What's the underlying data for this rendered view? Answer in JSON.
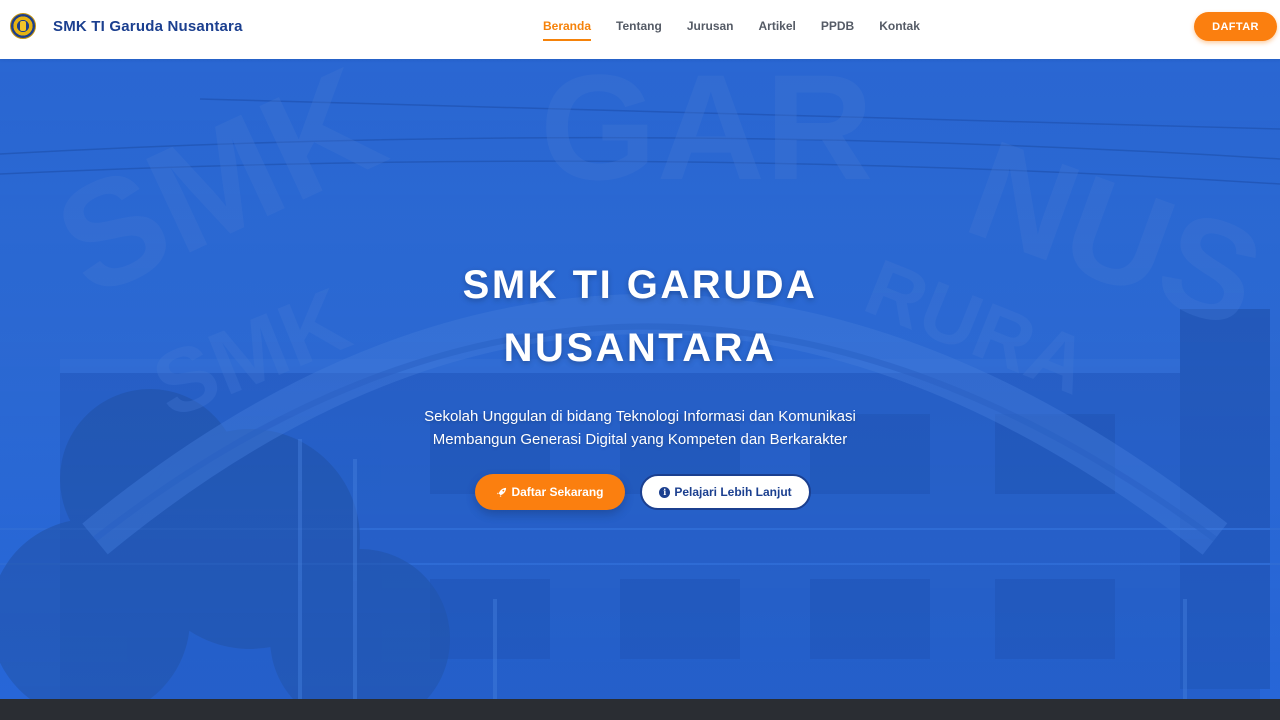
{
  "navbar": {
    "brand_name": "SMK TI Garuda Nusantara",
    "logo_icon": "school-emblem-icon",
    "links": [
      {
        "label": "Beranda",
        "active": true
      },
      {
        "label": "Tentang",
        "active": false
      },
      {
        "label": "Jurusan",
        "active": false
      },
      {
        "label": "Artikel",
        "active": false
      },
      {
        "label": "PPDB",
        "active": false
      },
      {
        "label": "Kontak",
        "active": false
      }
    ],
    "cta_label": "DAFTAR"
  },
  "hero": {
    "title_line1": "SMK TI GARUDA",
    "title_line2": "NUSANTARA",
    "subtitle_line1": "Sekolah Unggulan di bidang Teknologi Informasi dan Komunikasi",
    "subtitle_line2": "Membangun Generasi Digital yang Kompeten dan Berkarakter",
    "primary_button": {
      "label": "Daftar Sekarang",
      "icon": "rocket-icon"
    },
    "secondary_button": {
      "label": "Pelajari Lebih Lanjut",
      "icon": "info-circle-icon"
    }
  },
  "colors": {
    "brand_blue": "#1b3f8f",
    "accent_orange": "#fb7f0f",
    "hero_blue": "#2c6bd6"
  }
}
